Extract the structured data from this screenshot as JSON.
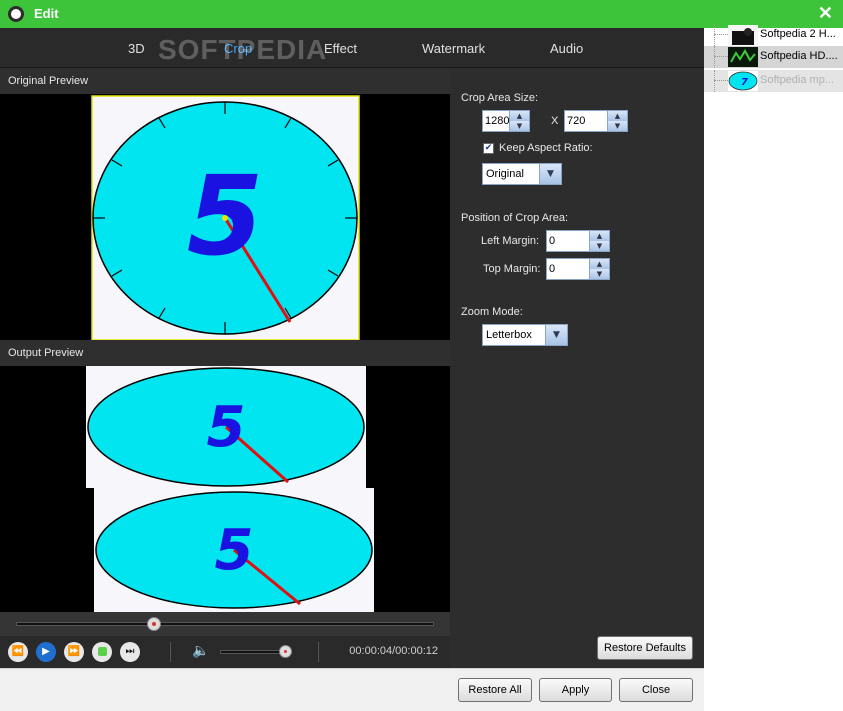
{
  "window": {
    "title": "Edit",
    "close_glyph": "✕",
    "watermark": "SOFTPEDIA"
  },
  "tabs": [
    {
      "label": "3D",
      "active": false
    },
    {
      "label": "Crop",
      "active": true
    },
    {
      "label": "Effect",
      "active": false
    },
    {
      "label": "Watermark",
      "active": false
    },
    {
      "label": "Audio",
      "active": false
    }
  ],
  "preview": {
    "original_label": "Original Preview",
    "output_label": "Output Preview",
    "clock_digit": "5"
  },
  "playback": {
    "time": "00:00:04/00:00:12",
    "progress_fraction": 0.33,
    "volume_fraction": 0.9,
    "buttons": {
      "rewind": "⏪",
      "play": "▶",
      "forward": "⏩",
      "next": "⏭",
      "volume": "🔈"
    }
  },
  "crop": {
    "area_size_label": "Crop Area Size:",
    "width": "1280",
    "x_sep": "X",
    "height": "720",
    "keep_aspect_label": "Keep Aspect Ratio:",
    "keep_aspect_checked": true,
    "check_glyph": "✔",
    "aspect_option": "Original",
    "position_label": "Position of Crop Area:",
    "left_margin_label": "Left Margin:",
    "left_margin": "0",
    "top_margin_label": "Top Margin:",
    "top_margin": "0",
    "zoom_mode_label": "Zoom Mode:",
    "zoom_mode": "Letterbox",
    "restore_defaults": "Restore Defaults"
  },
  "spin_glyphs": {
    "up": "▲",
    "down": "▼",
    "dropdown": "▼"
  },
  "footer": {
    "restore_all": "Restore All",
    "apply": "Apply",
    "close": "Close"
  },
  "files": [
    {
      "name": "Softpedia 2 H...",
      "state": "normal"
    },
    {
      "name": "Softpedia HD....",
      "state": "selected"
    },
    {
      "name": "Softpedia mp...",
      "state": "faded"
    }
  ],
  "colors": {
    "titlebar": "#3ec43a",
    "active_tab": "#3fa7ff",
    "clock_face": "#00e5f0",
    "digit": "#1a12e0",
    "hand": "#e01010"
  }
}
